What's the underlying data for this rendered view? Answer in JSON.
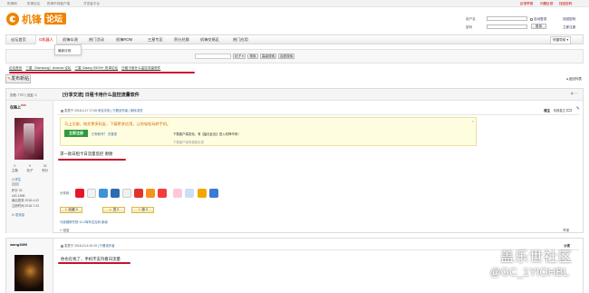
{
  "topbar": {
    "links": [
      "机锋网",
      "机锋论坛",
      "机锋市场客户端",
      "开发者平台"
    ],
    "right_links": [
      "反馈举报",
      "问题反馈",
      "找回密码"
    ]
  },
  "logo": {
    "text": "机锋论坛"
  },
  "login": {
    "user_label": "用户名",
    "pass_label": "密码",
    "auto_login": "自动登录",
    "find_pw": "找回密码",
    "login_btn": "登录",
    "register_btn": "立即注册"
  },
  "nav": {
    "items": [
      "论坛首页",
      "G机器人",
      "机锋众测",
      "热门活动",
      "机锋ROM",
      "三星专区",
      "积分兑换",
      "机锋交易区",
      "热门应用"
    ],
    "active_index": 1,
    "right": "快捷导航"
  },
  "dropdown": {
    "label": "最新评测"
  },
  "search": {
    "type_label": "帖子",
    "btn": "搜索",
    "btn2": "高级搜索",
    "btn3": "百度搜索"
  },
  "breadcrumb": [
    "论坛首页",
    "三星（Samsung）Android 论坛",
    "三星 Galaxy S9/S9+ 安卓论坛",
    "日租卡用什么监控流量软件"
  ],
  "actions": {
    "new_post": "发布新帖",
    "back_list": "返回列表"
  },
  "post1": {
    "views": "查看: 7757",
    "replies": "回复: 2",
    "title": "[分享交流] 日租卡用什么监控流量软件",
    "author": {
      "name": "在路上",
      "sup": "2018",
      "stats": [
        {
          "v": "0",
          "k": "主题"
        },
        {
          "v": "9",
          "k": "帖子"
        },
        {
          "v": "32",
          "k": "积分"
        }
      ],
      "rank": "小学生",
      "info": [
        {
          "k": "积分",
          "v": "32"
        },
        {
          "k": "UID",
          "v": "1898"
        },
        {
          "k": "最后登录",
          "v": "2018-4-22"
        },
        {
          "k": "注册时间",
          "v": "2018-7-24"
        }
      ],
      "pm": "发消息"
    },
    "meta": "发表于 2018-4-17 17:08",
    "meta_links": [
      "来自手机",
      "只看该作者",
      "倒序浏览"
    ],
    "floor": "楼主",
    "jump": "电梯直达",
    "notice_title": "马上注册，结交更多机友，下载更多应用，让你轻松玩转手机。",
    "notice_btn": "立即注册",
    "notice_text": "已有帐号？ 去登录",
    "notice_right": "下载客户端发帖，有【猛击此处】进入机锋市场！",
    "notice_foot": "下载客户端有更新实惠",
    "body": "求一款日租卡日流量监控 谢谢",
    "share_label": "分享到：",
    "votes": [
      "收藏 0",
      "顶 0",
      "踩 0"
    ],
    "foot": "马钟健研究院  12-4驾车空见码 新颖",
    "reply": "回复",
    "report": "举报"
  },
  "post2": {
    "author": "wang3890",
    "meta": "发表于 2018-10-6 20:19",
    "meta_links": [
      "只看该作者"
    ],
    "floor": "沙发",
    "body": "你也在找了，手机不支持看日流量"
  },
  "watermark": {
    "line1": "盖乐世社区",
    "line2": "@GC_1YIOHBL"
  },
  "colors": {
    "accent": "#c8102e",
    "brand_orange": "#f08300",
    "link": "#336699"
  }
}
